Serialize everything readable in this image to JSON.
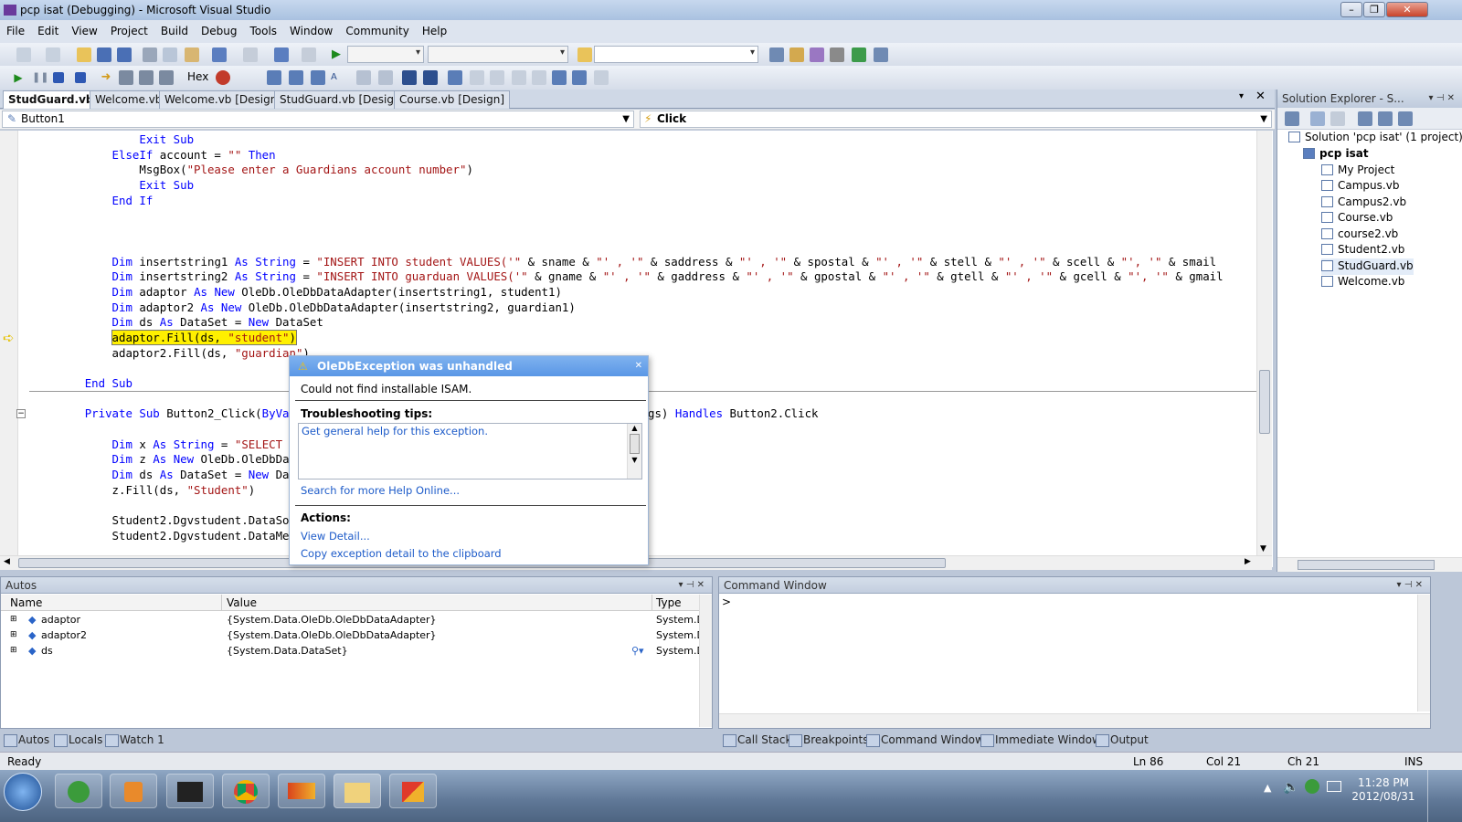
{
  "window": {
    "title": "pcp isat (Debugging) - Microsoft Visual Studio"
  },
  "menu": [
    "File",
    "Edit",
    "View",
    "Project",
    "Build",
    "Debug",
    "Tools",
    "Window",
    "Community",
    "Help"
  ],
  "toolbar2": {
    "hex_label": "Hex"
  },
  "tabs": [
    "StudGuard.vb",
    "Welcome.vb",
    "Welcome.vb [Design]",
    "StudGuard.vb [Design]",
    "Course.vb [Design]"
  ],
  "navbar": {
    "object": "Button1",
    "event": "Click"
  },
  "code_lines": [
    {
      "indent": 16,
      "parts": [
        {
          "t": "Exit Sub",
          "c": "kw"
        }
      ]
    },
    {
      "indent": 12,
      "parts": [
        {
          "t": "ElseIf",
          "c": "kw"
        },
        {
          "t": " account = "
        },
        {
          "t": "\"\"",
          "c": "str"
        },
        {
          "t": " "
        },
        {
          "t": "Then",
          "c": "kw"
        }
      ]
    },
    {
      "indent": 16,
      "parts": [
        {
          "t": "MsgBox("
        },
        {
          "t": "\"Please enter a Guardians account number\"",
          "c": "str"
        },
        {
          "t": ")"
        }
      ]
    },
    {
      "indent": 16,
      "parts": [
        {
          "t": "Exit Sub",
          "c": "kw"
        }
      ]
    },
    {
      "indent": 12,
      "parts": [
        {
          "t": "End If",
          "c": "kw"
        }
      ]
    },
    {
      "indent": 0,
      "parts": []
    },
    {
      "indent": 0,
      "parts": []
    },
    {
      "indent": 0,
      "parts": []
    },
    {
      "indent": 12,
      "parts": [
        {
          "t": "Dim",
          "c": "kw"
        },
        {
          "t": " insertstring1 "
        },
        {
          "t": "As",
          "c": "kw"
        },
        {
          "t": " "
        },
        {
          "t": "String",
          "c": "kw"
        },
        {
          "t": " = "
        },
        {
          "t": "\"INSERT INTO student VALUES('\"",
          "c": "str"
        },
        {
          "t": " & sname & "
        },
        {
          "t": "\"' , '\"",
          "c": "str"
        },
        {
          "t": " & saddress & "
        },
        {
          "t": "\"' , '\"",
          "c": "str"
        },
        {
          "t": " & spostal & "
        },
        {
          "t": "\"' , '\"",
          "c": "str"
        },
        {
          "t": " & stell & "
        },
        {
          "t": "\"' , '\"",
          "c": "str"
        },
        {
          "t": " & scell & "
        },
        {
          "t": "\"', '\"",
          "c": "str"
        },
        {
          "t": " & smail"
        }
      ]
    },
    {
      "indent": 12,
      "parts": [
        {
          "t": "Dim",
          "c": "kw"
        },
        {
          "t": " insertstring2 "
        },
        {
          "t": "As",
          "c": "kw"
        },
        {
          "t": " "
        },
        {
          "t": "String",
          "c": "kw"
        },
        {
          "t": " = "
        },
        {
          "t": "\"INSERT INTO guarduan VALUES('\"",
          "c": "str"
        },
        {
          "t": " & gname & "
        },
        {
          "t": "\"' , '\"",
          "c": "str"
        },
        {
          "t": " & gaddress & "
        },
        {
          "t": "\"' , '\"",
          "c": "str"
        },
        {
          "t": " & gpostal & "
        },
        {
          "t": "\"' , '\"",
          "c": "str"
        },
        {
          "t": " & gtell & "
        },
        {
          "t": "\"' , '\"",
          "c": "str"
        },
        {
          "t": " & gcell & "
        },
        {
          "t": "\"', '\"",
          "c": "str"
        },
        {
          "t": " & gmail"
        }
      ]
    },
    {
      "indent": 12,
      "parts": [
        {
          "t": "Dim",
          "c": "kw"
        },
        {
          "t": " adaptor "
        },
        {
          "t": "As",
          "c": "kw"
        },
        {
          "t": " "
        },
        {
          "t": "New",
          "c": "kw"
        },
        {
          "t": " OleDb.OleDbDataAdapter(insertstring1, student1)"
        }
      ]
    },
    {
      "indent": 12,
      "parts": [
        {
          "t": "Dim",
          "c": "kw"
        },
        {
          "t": " adaptor2 "
        },
        {
          "t": "As",
          "c": "kw"
        },
        {
          "t": " "
        },
        {
          "t": "New",
          "c": "kw"
        },
        {
          "t": " OleDb.OleDbDataAdapter(insertstring2, guardian1)"
        }
      ]
    },
    {
      "indent": 12,
      "parts": [
        {
          "t": "Dim",
          "c": "kw"
        },
        {
          "t": " ds "
        },
        {
          "t": "As",
          "c": "kw"
        },
        {
          "t": " DataSet = "
        },
        {
          "t": "New",
          "c": "kw"
        },
        {
          "t": " DataSet"
        }
      ]
    },
    {
      "indent": 12,
      "hl": true,
      "parts": [
        {
          "t": "adaptor.Fill(ds, "
        },
        {
          "t": "\"student\"",
          "c": "str"
        },
        {
          "t": ")"
        }
      ]
    },
    {
      "indent": 12,
      "parts": [
        {
          "t": "adaptor2.Fill(ds, "
        },
        {
          "t": "\"guardian\"",
          "c": "str"
        },
        {
          "t": ")"
        }
      ]
    },
    {
      "indent": 0,
      "parts": []
    },
    {
      "indent": 8,
      "parts": [
        {
          "t": "End Sub",
          "c": "kw"
        }
      ]
    },
    {
      "indent": 0,
      "parts": []
    },
    {
      "indent": 8,
      "parts": [
        {
          "t": "Private Sub",
          "c": "kw"
        },
        {
          "t": " Button2_Click("
        },
        {
          "t": "ByVal",
          "c": "kw"
        },
        {
          "t": " s"
        }
      ]
    },
    {
      "indent": 0,
      "parts": []
    },
    {
      "indent": 12,
      "parts": [
        {
          "t": "Dim",
          "c": "kw"
        },
        {
          "t": " x "
        },
        {
          "t": "As",
          "c": "kw"
        },
        {
          "t": " "
        },
        {
          "t": "String",
          "c": "kw"
        },
        {
          "t": " = "
        },
        {
          "t": "\"SELECT * F",
          "c": "str"
        }
      ]
    },
    {
      "indent": 12,
      "parts": [
        {
          "t": "Dim",
          "c": "kw"
        },
        {
          "t": " z "
        },
        {
          "t": "As",
          "c": "kw"
        },
        {
          "t": " "
        },
        {
          "t": "New",
          "c": "kw"
        },
        {
          "t": " OleDb.OleDbDataA"
        }
      ]
    },
    {
      "indent": 12,
      "parts": [
        {
          "t": "Dim",
          "c": "kw"
        },
        {
          "t": " ds "
        },
        {
          "t": "As",
          "c": "kw"
        },
        {
          "t": " DataSet = "
        },
        {
          "t": "New",
          "c": "kw"
        },
        {
          "t": " DataS"
        }
      ]
    },
    {
      "indent": 12,
      "parts": [
        {
          "t": "z.Fill(ds, "
        },
        {
          "t": "\"Student\"",
          "c": "str"
        },
        {
          "t": ")"
        }
      ]
    },
    {
      "indent": 0,
      "parts": []
    },
    {
      "indent": 12,
      "parts": [
        {
          "t": "Student2.Dgvstudent.DataSourc"
        }
      ]
    },
    {
      "indent": 12,
      "parts": [
        {
          "t": "Student2.Dgvstudent.DataMembe"
        }
      ]
    }
  ],
  "code_tail": {
    "handles_kw": "Handles",
    "handles_rest": " Button2.Click",
    "gs": "gs)"
  },
  "exception": {
    "title": "OleDbException was unhandled",
    "message": "Could not find installable ISAM.",
    "tips_header": "Troubleshooting tips:",
    "tip_link": "Get general help for this exception.",
    "search_link": "Search for more Help Online...",
    "actions_header": "Actions:",
    "action_view": "View Detail...",
    "action_copy": "Copy exception detail to the clipboard"
  },
  "solution_explorer": {
    "title": "Solution Explorer - S...",
    "solution": "Solution 'pcp isat' (1 project)",
    "project": "pcp isat",
    "items": [
      "My Project",
      "Campus.vb",
      "Campus2.vb",
      "Course.vb",
      "course2.vb",
      "Student2.vb",
      "StudGuard.vb",
      "Welcome.vb"
    ]
  },
  "autos": {
    "title": "Autos",
    "columns": [
      "Name",
      "Value",
      "Type"
    ],
    "rows": [
      {
        "name": "adaptor",
        "value": "{System.Data.OleDb.OleDbDataAdapter}",
        "type": "System.D"
      },
      {
        "name": "adaptor2",
        "value": "{System.Data.OleDb.OleDbDataAdapter}",
        "type": "System.D"
      },
      {
        "name": "ds",
        "value": "{System.Data.DataSet}",
        "type": "System.D"
      }
    ]
  },
  "command_window": {
    "title": "Command Window",
    "prompt": ">"
  },
  "bottom_tabs_left": [
    "Autos",
    "Locals",
    "Watch 1"
  ],
  "bottom_tabs_right": [
    "Call Stack",
    "Breakpoints",
    "Command Window",
    "Immediate Window",
    "Output"
  ],
  "status": {
    "text": "Ready",
    "ln": "Ln 86",
    "col": "Col 21",
    "ch": "Ch 21",
    "mode": "INS"
  },
  "clock": {
    "time": "11:28 PM",
    "date": "2012/08/31"
  }
}
